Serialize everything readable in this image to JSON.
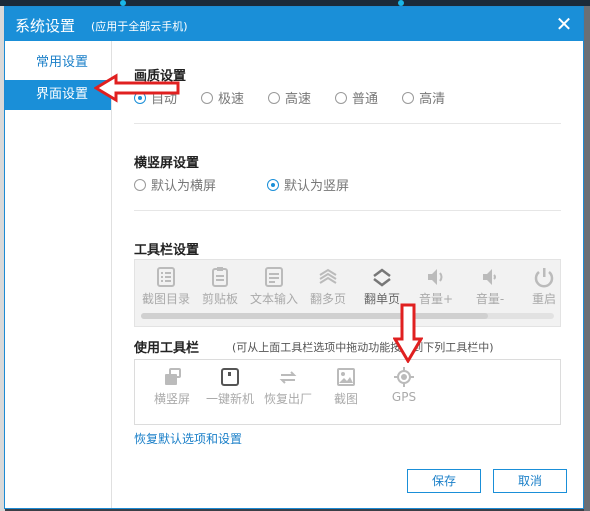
{
  "dialog": {
    "title": "系统设置",
    "subtitle": "(应用于全部云手机)",
    "close_label": "✕"
  },
  "sidebar": {
    "items": [
      {
        "label": "常用设置",
        "active": false
      },
      {
        "label": "界面设置",
        "active": true
      }
    ]
  },
  "quality": {
    "title": "画质设置",
    "options": [
      {
        "label": "自动",
        "checked": true
      },
      {
        "label": "极速",
        "checked": false
      },
      {
        "label": "高速",
        "checked": false
      },
      {
        "label": "普通",
        "checked": false
      },
      {
        "label": "高清",
        "checked": false
      }
    ]
  },
  "orientation": {
    "title": "横竖屏设置",
    "options": [
      {
        "label": "默认为横屏",
        "checked": false
      },
      {
        "label": "默认为竖屏",
        "checked": true
      }
    ]
  },
  "toolbar": {
    "title": "工具栏设置",
    "items": [
      {
        "label": "截图目录",
        "icon": "screenshot-folder-icon"
      },
      {
        "label": "剪贴板",
        "icon": "clipboard-icon"
      },
      {
        "label": "文本输入",
        "icon": "text-input-icon"
      },
      {
        "label": "翻多页",
        "icon": "page-multi-icon"
      },
      {
        "label": "翻单页",
        "icon": "page-single-icon"
      },
      {
        "label": "音量+",
        "icon": "volume-up-icon"
      },
      {
        "label": "音量-",
        "icon": "volume-down-icon"
      },
      {
        "label": "重启",
        "icon": "power-icon"
      }
    ]
  },
  "used_toolbar": {
    "title": "使用工具栏",
    "hint": "(可从上面工具栏选项中拖动功能按钮到下列工具栏中)",
    "items": [
      {
        "label": "横竖屏",
        "icon": "rotate-icon"
      },
      {
        "label": "一键新机",
        "icon": "new-device-icon"
      },
      {
        "label": "恢复出厂",
        "icon": "factory-reset-icon"
      },
      {
        "label": "截图",
        "icon": "screenshot-icon"
      },
      {
        "label": "GPS",
        "icon": "gps-icon"
      }
    ]
  },
  "reset_link": "恢复默认选项和设置",
  "buttons": {
    "save": "保存",
    "cancel": "取消"
  },
  "colors": {
    "accent": "#1a8fd8",
    "annotation_arrow": "#e02020"
  }
}
